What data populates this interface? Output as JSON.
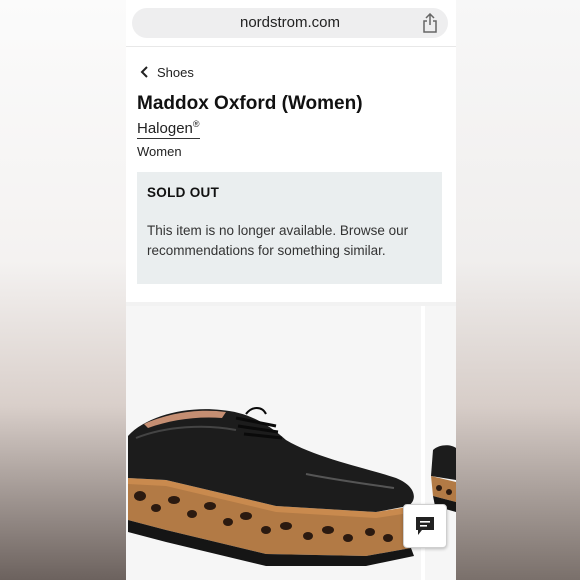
{
  "browser": {
    "url": "nordstrom.com"
  },
  "breadcrumb": {
    "label": "Shoes"
  },
  "product": {
    "title": "Maddox Oxford (Women)",
    "brand": "Halogen",
    "brand_mark": "®",
    "audience": "Women"
  },
  "availability": {
    "heading": "SOLD OUT",
    "message": "This item is no longer available. Browse our recommendations for something similar."
  },
  "icons": {
    "share": "share-icon",
    "back": "chevron-left-icon",
    "chat": "chat-icon"
  },
  "colors": {
    "notice_background": "#eaeeef",
    "text": "#111111"
  }
}
